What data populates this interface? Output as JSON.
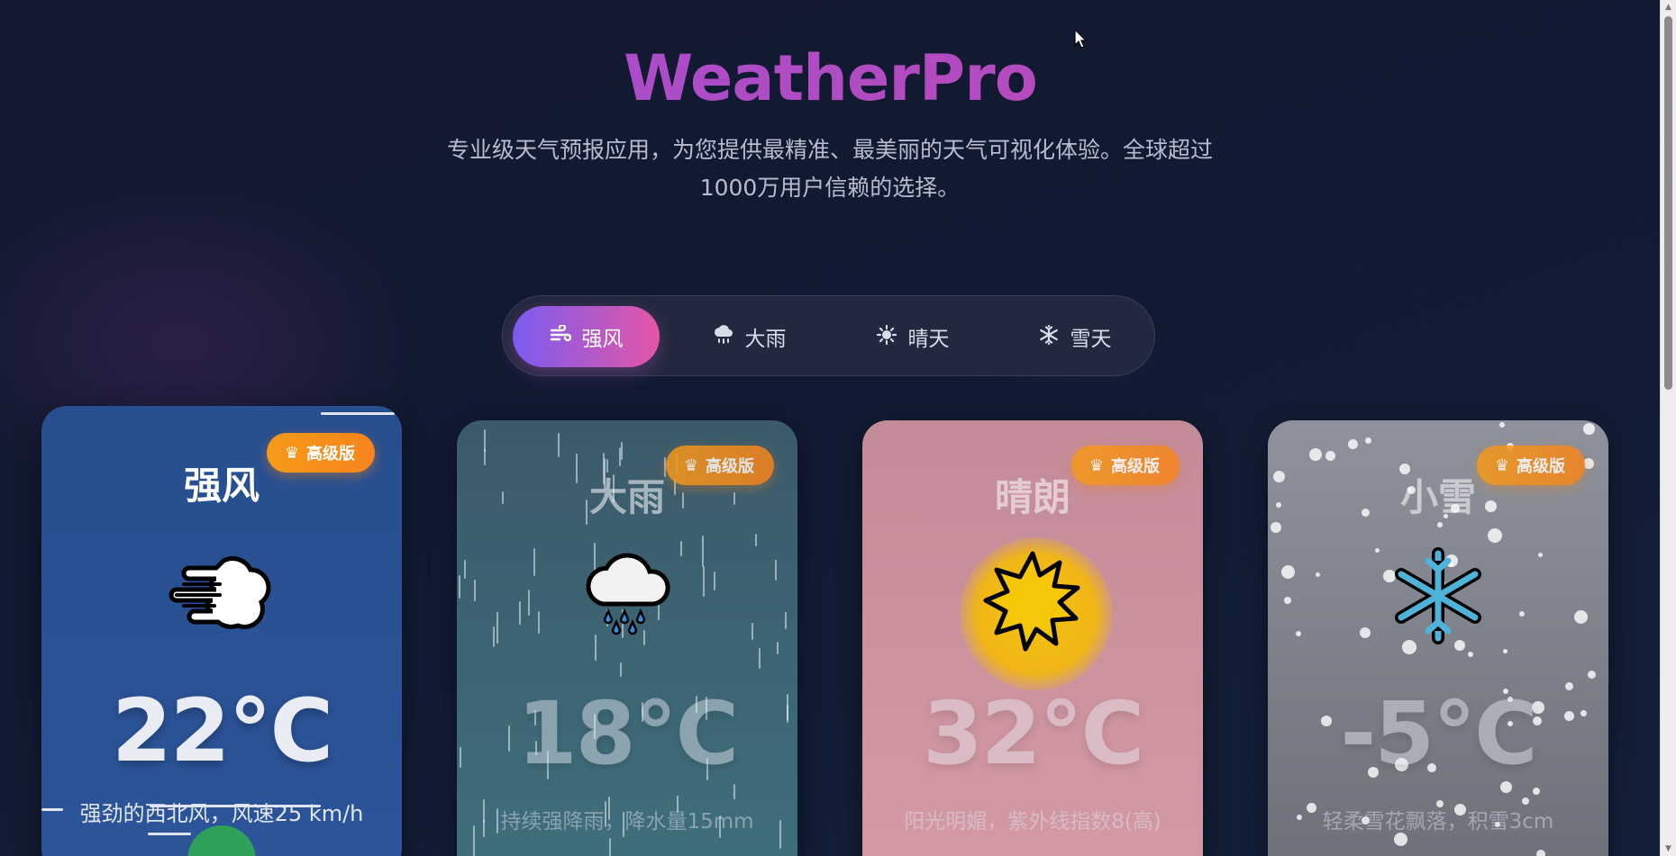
{
  "app": {
    "brand": "WeatherPro",
    "tagline": "专业级天气预报应用，为您提供最精准、最美丽的天气可视化体验。全球超过1000万用户信赖的选择。"
  },
  "tabs": [
    {
      "label": "强风",
      "icon": "wind-icon",
      "active": true
    },
    {
      "label": "大雨",
      "icon": "cloud-rain-icon",
      "active": false
    },
    {
      "label": "晴天",
      "icon": "sun-icon",
      "active": false
    },
    {
      "label": "雪天",
      "icon": "snowflake-icon",
      "active": false
    }
  ],
  "cards": [
    {
      "badge": "高级版",
      "title": "强风",
      "icon": "wind-face-icon",
      "temp": "22°C",
      "desc": "强劲的西北风，风速25 km/h",
      "color": "#2a5193"
    },
    {
      "badge": "高级版",
      "title": "大雨",
      "icon": "cloud-rain-icon",
      "temp": "18°C",
      "desc": "持续强降雨，降水量15mm",
      "color": "#3e6674"
    },
    {
      "badge": "高级版",
      "title": "晴朗",
      "icon": "sun-icon",
      "temp": "32°C",
      "desc": "阳光明媚，紫外线指数8(高)",
      "color": "#cc939e"
    },
    {
      "badge": "高级版",
      "title": "小雪",
      "icon": "snowflake-icon",
      "temp": "-5°C",
      "desc": "轻柔雪花飘落，积雪3cm",
      "color": "#7e818a"
    }
  ],
  "colors": {
    "accent_gradient_start": "#7a5cf0",
    "accent_gradient_end": "#e456a6",
    "badge": "#f7891c",
    "background": "#131b31"
  }
}
